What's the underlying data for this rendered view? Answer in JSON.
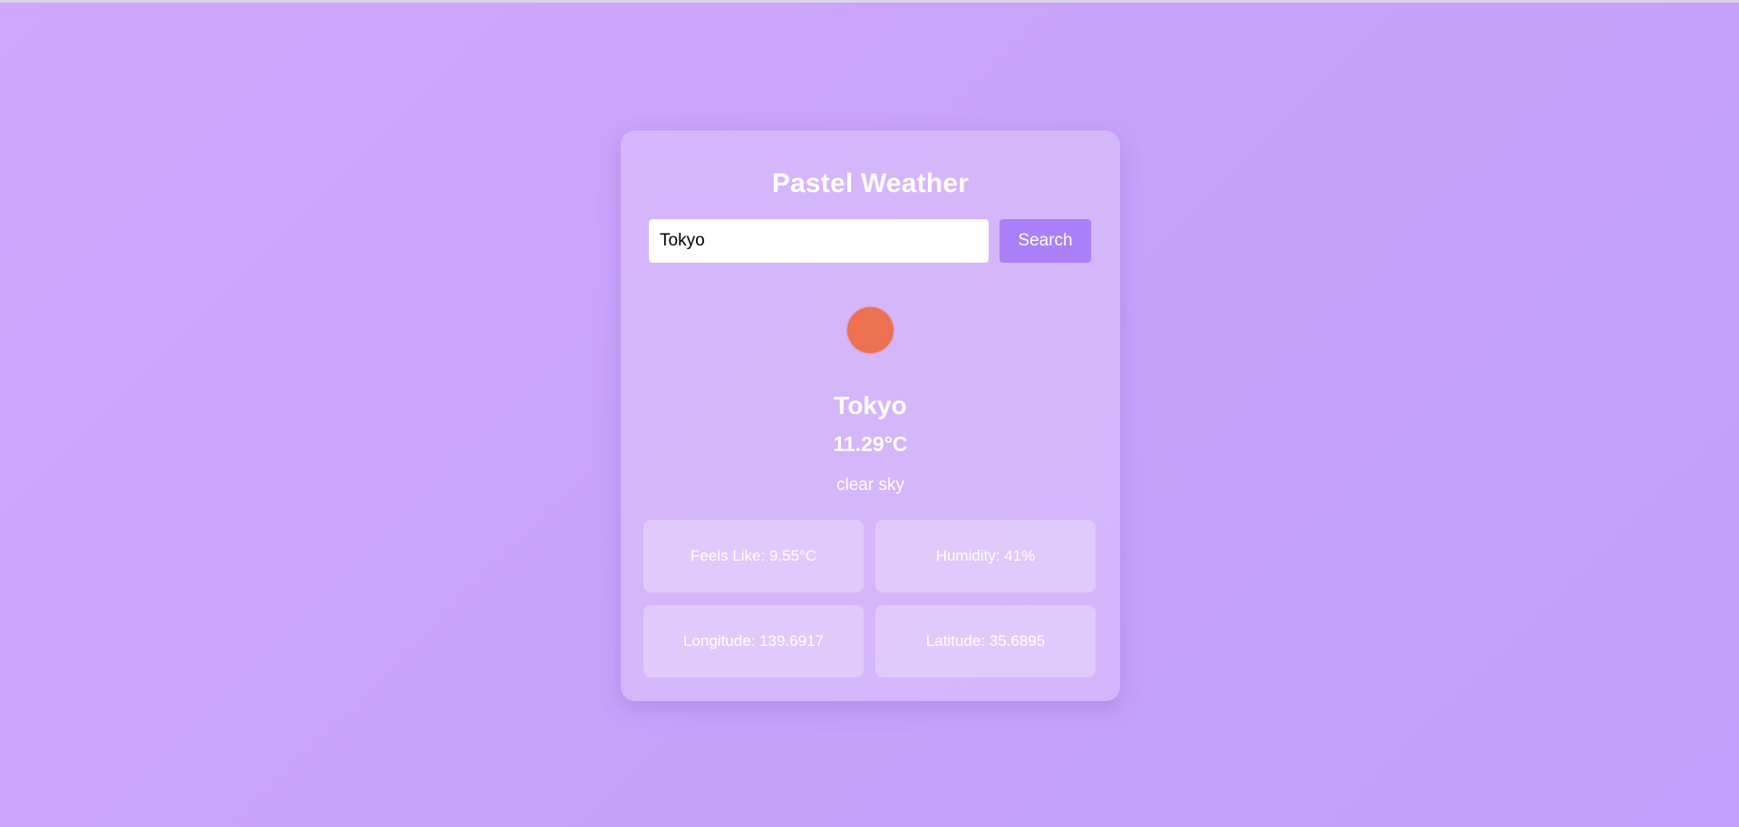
{
  "app": {
    "title": "Pastel Weather"
  },
  "search": {
    "value": "Tokyo",
    "button_label": "Search"
  },
  "weather": {
    "icon": "sun-icon",
    "icon_color": "#ec7152",
    "city": "Tokyo",
    "temperature": "11.29°C",
    "description": "clear sky"
  },
  "details": [
    {
      "label": "Feels Like: 9.55°C"
    },
    {
      "label": "Humidity: 41%"
    },
    {
      "label": "Longitude: 139.6917"
    },
    {
      "label": "Latitude: 35.6895"
    }
  ],
  "colors": {
    "background": "#c8a2fb",
    "accent": "#ab7ff7",
    "text": "#ffffff"
  }
}
